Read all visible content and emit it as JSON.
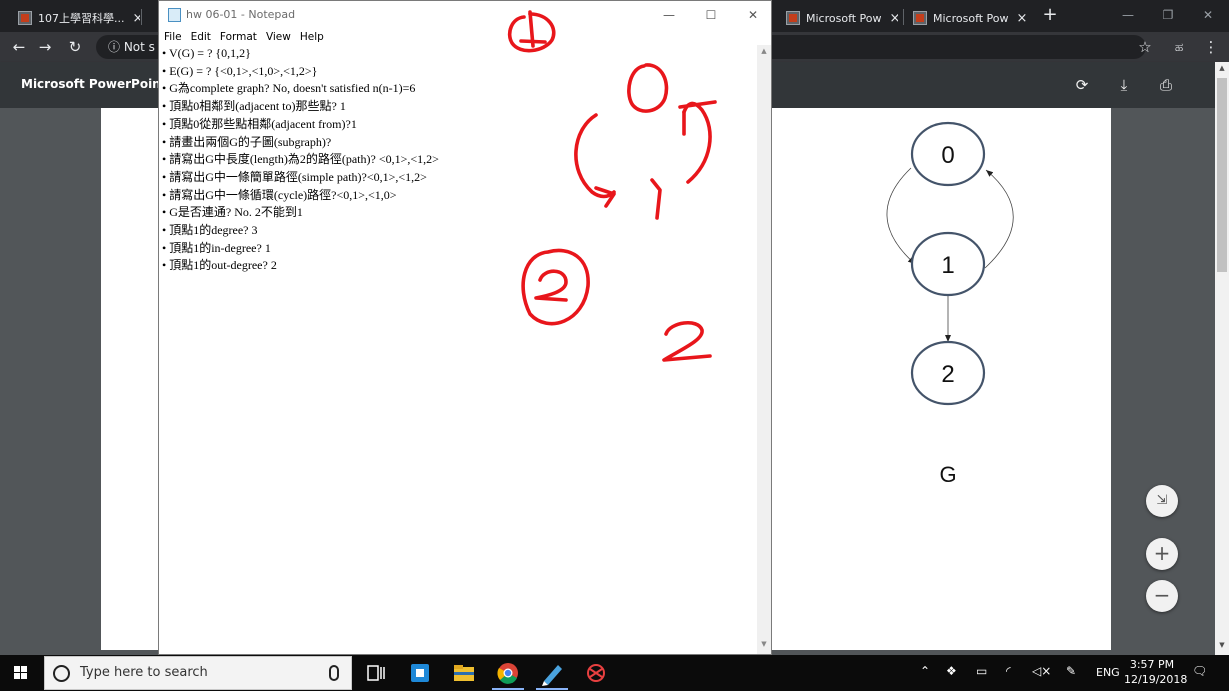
{
  "browser": {
    "tabs": [
      {
        "label": "107上學習科學..."
      },
      {
        "label": "Microsoft Pow"
      },
      {
        "label": "Microsoft Pow"
      }
    ],
    "address_prefix": "Not s",
    "new_tab": "+"
  },
  "pdf": {
    "title": "Microsoft PowerPoint - (",
    "graph": {
      "nodes": [
        "0",
        "1",
        "2"
      ],
      "edges": [
        [
          "0",
          "1"
        ],
        [
          "1",
          "0"
        ],
        [
          "1",
          "2"
        ]
      ],
      "caption": "G"
    },
    "zoom_fit": "fit-to-page",
    "zoom_in": "+",
    "zoom_out": "−"
  },
  "notepad": {
    "title": "hw 06-01 - Notepad",
    "menu": [
      "File",
      "Edit",
      "Format",
      "View",
      "Help"
    ],
    "lines": [
      "• V(G) = ? {0,1,2}",
      "• E(G) = ? {<0,1>,<1,0>,<1,2>}",
      "• G為complete graph? No, doesn't satisfied n(n-1)=6",
      "• 頂點0相鄰到(adjacent to)那些點? 1",
      "• 頂點0從那些點相鄰(adjacent from)?1",
      "• 請畫出兩個G的子圖(subgraph)?",
      "• 請寫出G中長度(length)為2的路徑(path)? <0,1>,<1,2>",
      "• 請寫出G中一條簡單路徑(simple path)?<0,1>,<1,2>",
      "• 請寫出G中一條循環(cycle)路徑?<0,1>,<1,0>",
      "• G是否連通? No. 2不能到1",
      "• 頂點1的degree? 3",
      "• 頂點1的in-degree? 1",
      "• 頂點1的out-degree? 2"
    ]
  },
  "taskbar": {
    "search_placeholder": "Type here to search",
    "language": "ENG",
    "time": "3:57 PM",
    "date": "12/19/2018"
  },
  "colors": {
    "ink": "#e8161b",
    "node_stroke": "#44546a"
  }
}
